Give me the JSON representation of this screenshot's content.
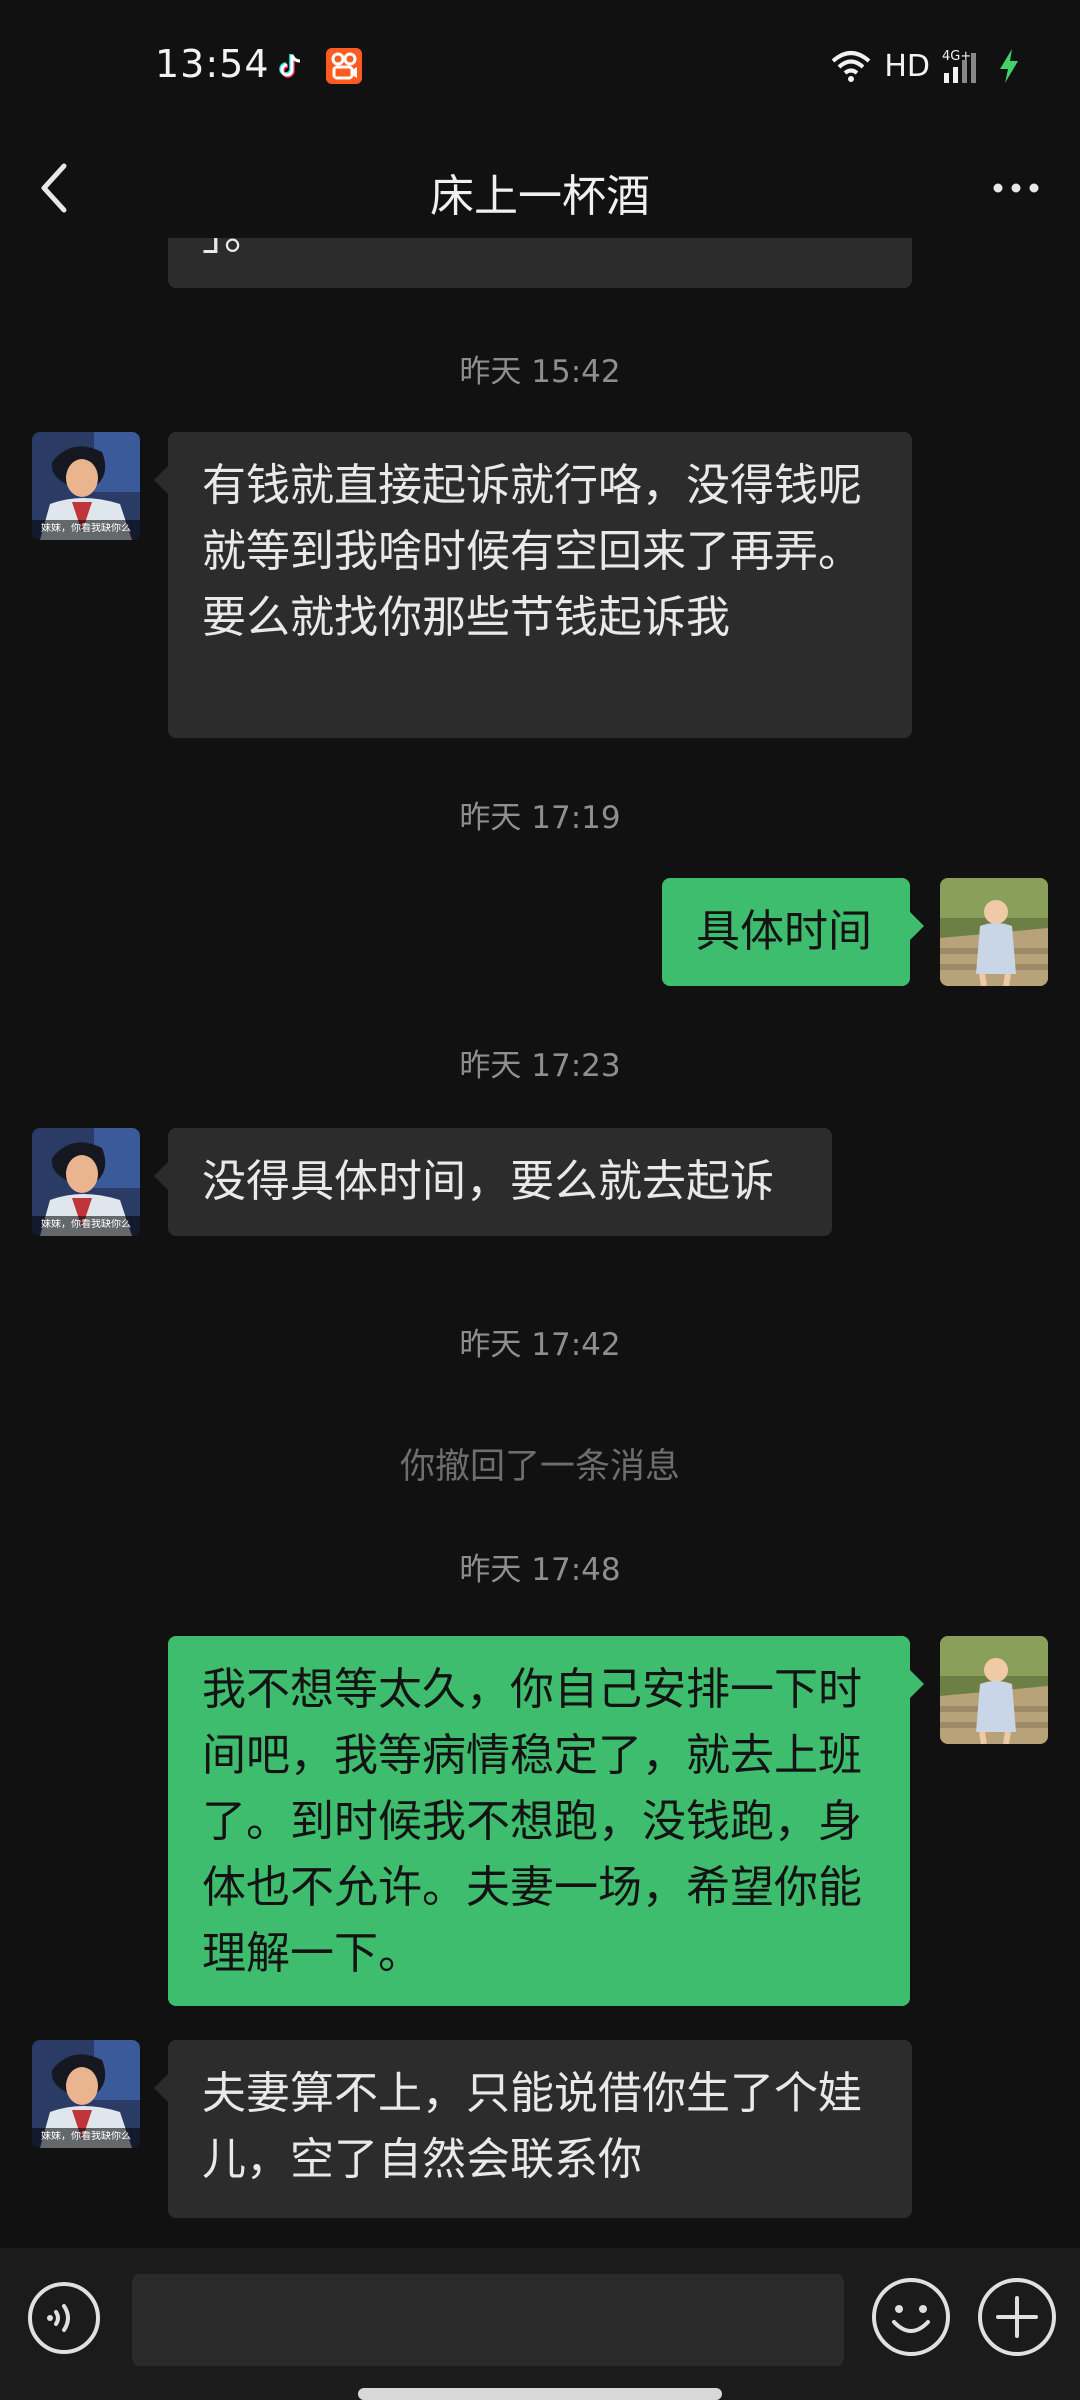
{
  "status_bar": {
    "time": "13:54",
    "network": "HD",
    "signal_label": "4G+",
    "icons": [
      "tiktok-icon",
      "kuaishou-icon",
      "wifi-icon",
      "signal-icon",
      "charging-icon"
    ]
  },
  "header": {
    "title": "床上一杯酒",
    "back_icon": "chevron-left-icon",
    "more_icon": "more-dots-icon"
  },
  "messages": [
    {
      "type": "in",
      "text": "」。",
      "clipped": true
    },
    {
      "type": "time",
      "text": "昨天 15:42"
    },
    {
      "type": "in",
      "text": "有钱就直接起诉就行咯，没得钱呢就等到我啥时候有空回来了再弄。　　要么就找你那些节钱起诉我",
      "avatar_caption": "妹妹，你看我缺你么"
    },
    {
      "type": "time",
      "text": "昨天 17:19"
    },
    {
      "type": "out",
      "text": "具体时间"
    },
    {
      "type": "time",
      "text": "昨天 17:23"
    },
    {
      "type": "in",
      "text": "没得具体时间，要么就去起诉",
      "avatar_caption": "妹妹，你看我缺你么"
    },
    {
      "type": "time",
      "text": "昨天 17:42"
    },
    {
      "type": "system",
      "text": "你撤回了一条消息"
    },
    {
      "type": "time",
      "text": "昨天 17:48"
    },
    {
      "type": "out",
      "text": "我不想等太久，你自己安排一下时间吧，我等病情稳定了，就去上班了。到时候我不想跑，没钱跑，身体也不允许。夫妻一场，希望你能理解一下。"
    },
    {
      "type": "in",
      "text": "夫妻算不上，只能说借你生了个娃儿，空了自然会联系你",
      "avatar_caption": "妹妹，你看我缺你么"
    }
  ],
  "input_bar": {
    "placeholder": "",
    "voice_icon": "voice-icon",
    "emoji_icon": "emoji-icon",
    "plus_icon": "plus-icon"
  },
  "colors": {
    "background": "#111111",
    "incoming_bubble": "#2c2c2c",
    "outgoing_bubble": "#3fbd6e",
    "timestamp": "#8e8e8e"
  }
}
